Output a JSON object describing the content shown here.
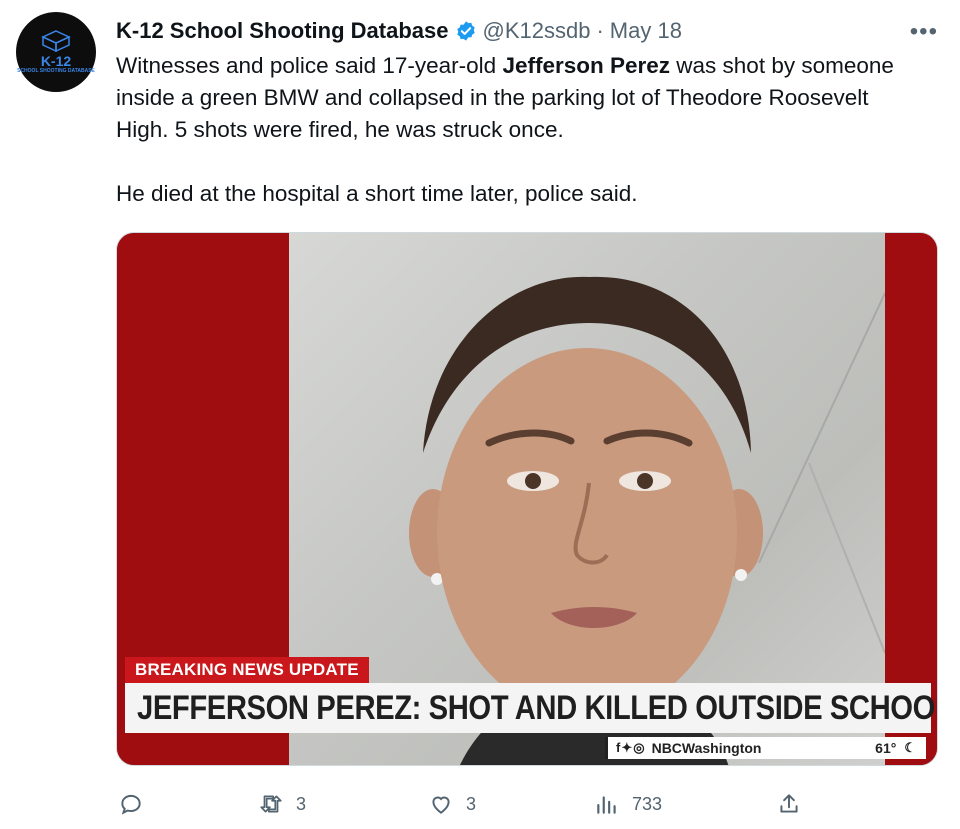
{
  "author": {
    "display_name": "K-12 School Shooting Database",
    "handle": "@K12ssdb",
    "separator": "·",
    "date": "May 18",
    "avatar_text": "K-12",
    "avatar_subtext": "SCHOOL SHOOTING DATABASE"
  },
  "more_label": "•••",
  "tweet": {
    "p1_before": "Witnesses and police said 17-year-old ",
    "p1_bold": "Jefferson Perez",
    "p1_after": " was shot by someone inside a green BMW and collapsed in the parking lot of Theodore Roosevelt High. 5 shots were fired, he was struck once.",
    "p2": "He died at the hospital a short time later, police said."
  },
  "media": {
    "breaking_label": "BREAKING NEWS UPDATE",
    "headline": "JEFFERSON PEREZ: SHOT AND KILLED OUTSIDE SCHOOL",
    "social_icons": "f✦◎",
    "station": "NBCWashington",
    "temperature": "61°",
    "weather_icon": "moon-cloud-icon"
  },
  "actions": {
    "reply_count": "",
    "retweet_count": "3",
    "like_count": "3",
    "views_count": "733"
  },
  "colors": {
    "accent_blue": "#1d9bf0",
    "breaking_red": "#c9171b",
    "muted_text": "#536471"
  }
}
